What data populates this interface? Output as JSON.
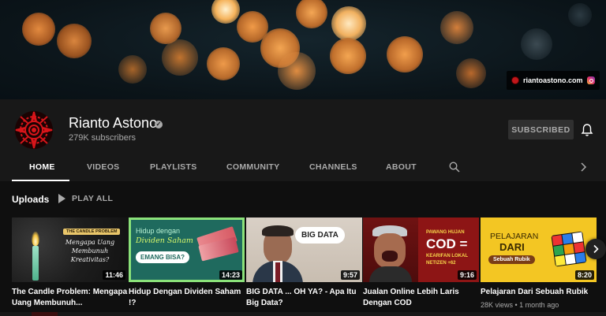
{
  "banner": {
    "site_link": "riantoastono.com",
    "site_icon": "globe-red-icon",
    "social_icon": "instagram-icon"
  },
  "channel": {
    "name": "Rianto Astono",
    "subscribers": "279K subscribers",
    "subscribe_button": "SUBSCRIBED",
    "verified_icon": "check-badge-icon",
    "bell_icon": "bell-icon",
    "avatar_color": "#d8151a"
  },
  "tabs": [
    {
      "label": "HOME",
      "active": true
    },
    {
      "label": "VIDEOS",
      "active": false
    },
    {
      "label": "PLAYLISTS",
      "active": false
    },
    {
      "label": "COMMUNITY",
      "active": false
    },
    {
      "label": "CHANNELS",
      "active": false
    },
    {
      "label": "ABOUT",
      "active": false
    }
  ],
  "uploads": {
    "heading": "Uploads",
    "play_all": "PLAY ALL",
    "videos": [
      {
        "title": "The Candle Problem: Mengapa Uang Membunuh...",
        "duration": "11:46",
        "thumb_badge": "THE CANDLE PROBLEM",
        "thumb_text": "Mengapa Uang Membunuh Kreativitas?"
      },
      {
        "title": "Hidup Dengan Dividen Saham !?",
        "duration": "14:23",
        "thumb_line1": "Hidup dengan",
        "thumb_line2": "Dividen Saham",
        "thumb_bubble": "EMANG BISA?"
      },
      {
        "title": "BIG DATA ... OH YA? - Apa Itu Big Data?",
        "duration": "9:57",
        "thumb_text": "BIG DATA"
      },
      {
        "title": "Jualan Online Lebih Laris Dengan COD",
        "duration": "9:16",
        "thumb_tag": "PAWANG HUJAN",
        "thumb_big": "COD =",
        "thumb_sub1": "KEARIFAN LOKAL",
        "thumb_sub2": "NETIZEN +62"
      },
      {
        "title": "Pelajaran Dari Sebuah Rubik",
        "duration": "8:20",
        "meta": "28K views • 1 month ago",
        "thumb_line1": "PELAJARAN",
        "thumb_line2": "DARI",
        "thumb_pill": "Sebuah Rubik"
      }
    ]
  },
  "colors": {
    "background": "#181818",
    "content_bg": "#0f0f0f",
    "text_secondary": "#aaaaaa",
    "accent_red": "#c0171b"
  }
}
